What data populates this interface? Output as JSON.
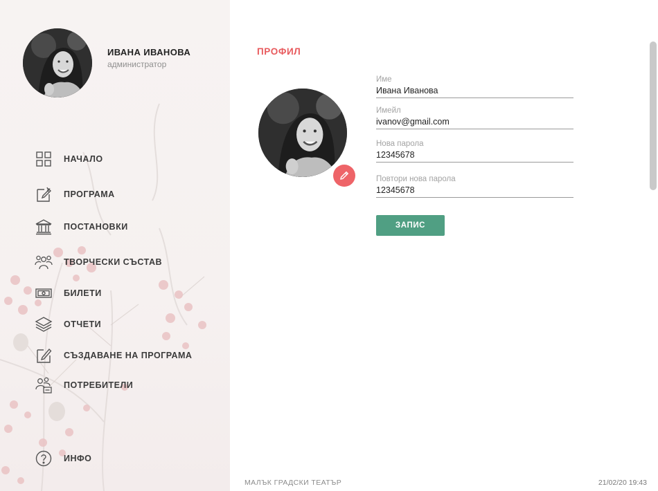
{
  "user": {
    "name": "ИВАНА ИВАНОВА",
    "role": "администратор"
  },
  "nav": {
    "items": [
      {
        "label": "НАЧАЛО",
        "icon": "grid-icon"
      },
      {
        "label": "ПРОГРАМА",
        "icon": "edit-star-icon"
      },
      {
        "label": "ПОСТАНОВКИ",
        "icon": "theater-building-icon"
      },
      {
        "label": "ТВОРЧЕСКИ СЪСТАВ",
        "icon": "people-group-icon"
      },
      {
        "label": "БИЛЕТИ",
        "icon": "ticket-icon"
      },
      {
        "label": "ОТЧЕТИ",
        "icon": "layers-icon"
      },
      {
        "label": "СЪЗДАВАНЕ НА ПРОГРАМА",
        "icon": "edit-icon"
      },
      {
        "label": "ПОТРЕБИТЕЛИ",
        "icon": "users-icon"
      }
    ],
    "info": {
      "label": "ИНФО",
      "icon": "question-icon"
    }
  },
  "profile": {
    "title": "ПРОФИЛ",
    "fields": {
      "name": {
        "label": "Име",
        "value": "Ивана Иванова"
      },
      "email": {
        "label": "Имейл",
        "value": "ivanov@gmail.com"
      },
      "new_password": {
        "label": "Нова парола",
        "value": "12345678"
      },
      "repeat_password": {
        "label": "Повтори нова парола",
        "value": "12345678"
      }
    },
    "save_label": "ЗАПИС"
  },
  "footer": {
    "brand": "МАЛЪК ГРАДСКИ ТЕАТЪР",
    "datetime": "21/02/20 19:43"
  },
  "colors": {
    "accent": "#e85a5d",
    "button": "#509f83",
    "sidebar_bg": "#f6f1f0"
  }
}
